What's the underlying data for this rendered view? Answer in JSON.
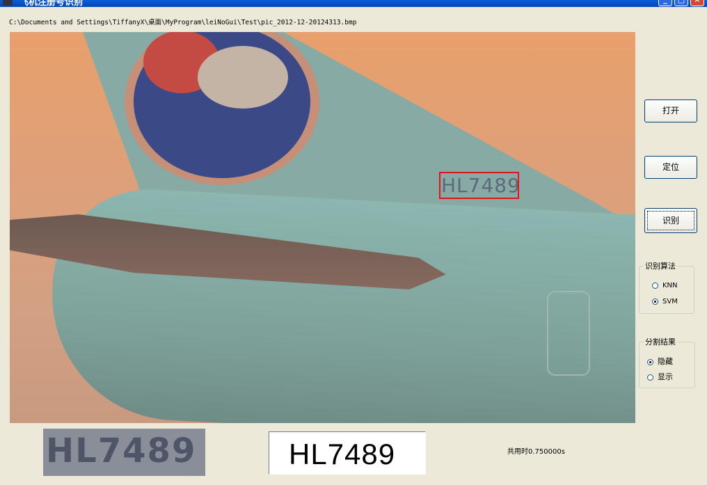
{
  "window": {
    "title": "飞机注册号识别",
    "controls": {
      "minimize": "_",
      "maximize": "□",
      "close": "×"
    }
  },
  "file_path": "C:\\Documents and Settings\\TiffanyX\\桌面\\MyProgram\\leiNoGui\\Test\\pic_2012-12-20124313.bmp",
  "image": {
    "registration_text": "HL7489",
    "highlight_color": "#e0121a"
  },
  "buttons": {
    "open": "打开",
    "locate": "定位",
    "recognize": "识别"
  },
  "algorithm_group": {
    "title": "识别算法",
    "options": [
      {
        "label": "KNN",
        "checked": false
      },
      {
        "label": "SVM",
        "checked": true
      }
    ]
  },
  "segmentation_group": {
    "title": "分割结果",
    "options": [
      {
        "label": "隐藏",
        "checked": true
      },
      {
        "label": "显示",
        "checked": false
      }
    ]
  },
  "plate_crop_text": "HL7489",
  "result_text": "HL7489",
  "timing_text": "共用时0.750000s"
}
